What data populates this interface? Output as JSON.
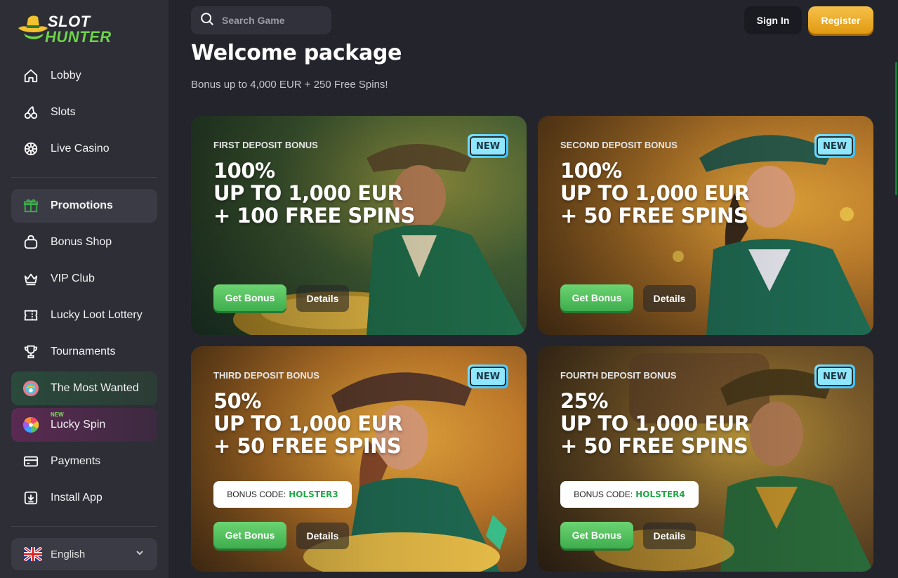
{
  "brand": {
    "line1": "SLOT",
    "line2": "HUNTER"
  },
  "header": {
    "search_placeholder": "Search Game",
    "signin_label": "Sign In",
    "register_label": "Register"
  },
  "sidebar": {
    "items": [
      {
        "label": "Lobby",
        "icon": "home-icon"
      },
      {
        "label": "Slots",
        "icon": "cherry-icon"
      },
      {
        "label": "Live Casino",
        "icon": "roulette-icon"
      },
      {
        "label": "Promotions",
        "icon": "gift-icon"
      },
      {
        "label": "Bonus Shop",
        "icon": "bag-icon"
      },
      {
        "label": "VIP Club",
        "icon": "crown-icon"
      },
      {
        "label": "Lucky Loot Lottery",
        "icon": "ticket-icon"
      },
      {
        "label": "Tournaments",
        "icon": "trophy-icon"
      },
      {
        "label": "The Most Wanted",
        "icon": "wanted-icon"
      },
      {
        "label": "Lucky Spin",
        "icon": "wheel-icon",
        "tag": "NEW"
      },
      {
        "label": "Payments",
        "icon": "card-icon"
      },
      {
        "label": "Install App",
        "icon": "download-icon"
      }
    ],
    "language": "English"
  },
  "main": {
    "title": "Welcome package",
    "subtitle": "Bonus up to 4,000 EUR + 250 Free Spins!",
    "cards": [
      {
        "kicker": "FIRST DEPOSIT BONUS",
        "line1": "100%",
        "line2": "UP TO 1,000 EUR",
        "line3": "+ 100 FREE SPINS",
        "badge": "NEW",
        "get_label": "Get Bonus",
        "details_label": "Details"
      },
      {
        "kicker": "SECOND DEPOSIT BONUS",
        "line1": "100%",
        "line2": "UP TO 1,000 EUR",
        "line3": "+ 50 FREE SPINS",
        "badge": "NEW",
        "get_label": "Get Bonus",
        "details_label": "Details"
      },
      {
        "kicker": "THIRD DEPOSIT BONUS",
        "line1": "50%",
        "line2": "UP TO 1,000 EUR",
        "line3": "+ 50 FREE SPINS",
        "badge": "NEW",
        "code_label": "BONUS CODE:",
        "code": "HOLSTER3",
        "get_label": "Get Bonus",
        "details_label": "Details"
      },
      {
        "kicker": "FOURTH DEPOSIT BONUS",
        "line1": "25%",
        "line2": "UP TO 1,000 EUR",
        "line3": "+ 50 FREE SPINS",
        "badge": "NEW",
        "code_label": "BONUS CODE:",
        "code": "HOLSTER4",
        "get_label": "Get Bonus",
        "details_label": "Details"
      }
    ]
  },
  "colors": {
    "accent_green": "#3fae4e",
    "accent_gold": "#e19a12",
    "badge_cyan": "#8ee7ff",
    "bg": "#24252c",
    "sidebar_bg": "#2d2e36"
  }
}
